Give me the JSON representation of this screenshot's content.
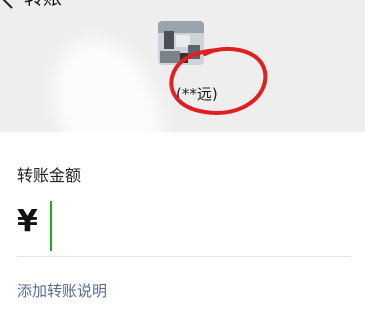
{
  "header": {
    "title": "转账",
    "back_icon": "chevron-left-icon"
  },
  "payee": {
    "display_name": "(**远)",
    "avatar_icon": "avatar-photo"
  },
  "amount": {
    "label": "转账金额",
    "currency_symbol": "¥",
    "value": "",
    "cursor_color": "#1aad19"
  },
  "note_link": "添加转账说明",
  "colors": {
    "header_bg": "#eeeeee",
    "link": "#576b95",
    "annotation": "#e02020"
  }
}
